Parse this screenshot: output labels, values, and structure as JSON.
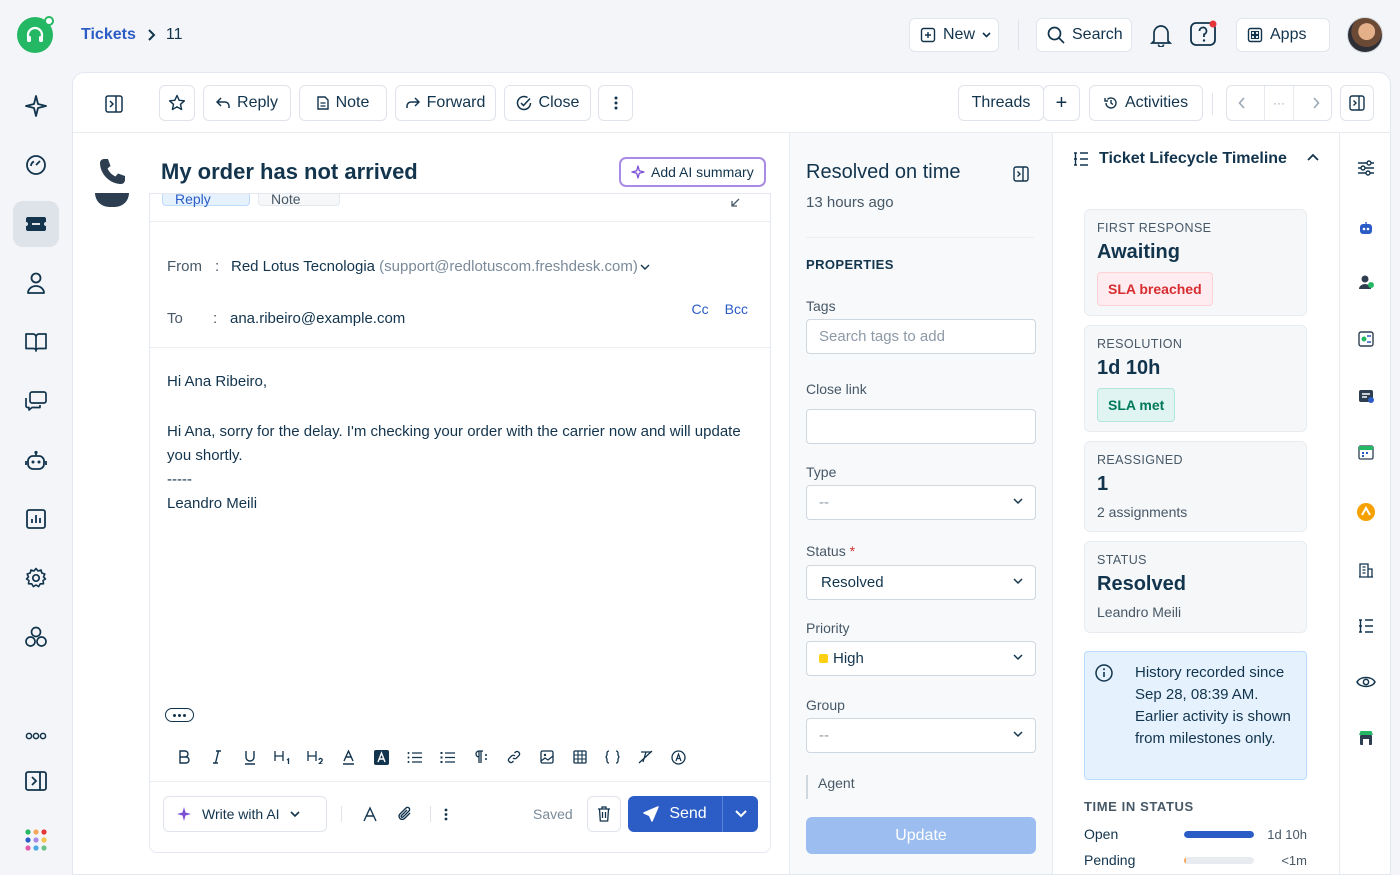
{
  "breadcrumb": {
    "parent": "Tickets",
    "separator": ">",
    "current": "11"
  },
  "topbar": {
    "new_label": "New",
    "search_label": "Search",
    "apps_label": "Apps"
  },
  "toolbar": {
    "reply": "Reply",
    "note": "Note",
    "forward": "Forward",
    "close": "Close",
    "threads": "Threads",
    "add": "+",
    "activities": "Activities",
    "ellipsis": "···"
  },
  "ticket": {
    "subject": "My order has not arrived",
    "ai_summary": "Add AI summary"
  },
  "editor": {
    "tab_reply": "Reply",
    "tab_note": "Note",
    "from_label": "From",
    "from_name": "Red Lotus Tecnologia",
    "from_email": "(support@redlotuscom.freshdesk.com)",
    "to_label": "To",
    "to_email": "ana.ribeiro@example.com",
    "cc": "Cc",
    "bcc": "Bcc",
    "body": [
      "Hi Ana Ribeiro,",
      "",
      "Hi Ana, sorry for the delay. I'm checking your order with the carrier now and will update you shortly.",
      "-----",
      "Leandro Meili"
    ],
    "write_ai": "Write with AI",
    "saved": "Saved",
    "send": "Send"
  },
  "properties": {
    "status_title": "Resolved on time",
    "status_time": "13 hours ago",
    "section": "PROPERTIES",
    "tags_label": "Tags",
    "tags_placeholder": "Search tags to add",
    "close_link_label": "Close link",
    "type_label": "Type",
    "type_value": "--",
    "status_label": "Status",
    "status_required": "*",
    "status_value": "Resolved",
    "priority_label": "Priority",
    "priority_value": "High",
    "priority_color": "#ffd012",
    "group_label": "Group",
    "group_value": "--",
    "agent_label": "Agent",
    "update": "Update"
  },
  "timeline": {
    "title": "Ticket Lifecycle Timeline",
    "first_response": {
      "label": "FIRST RESPONSE",
      "value": "Awaiting",
      "badge": "SLA breached"
    },
    "resolution": {
      "label": "RESOLUTION",
      "value": "1d 10h",
      "badge": "SLA met"
    },
    "reassigned": {
      "label": "REASSIGNED",
      "value": "1",
      "note": "2 assignments"
    },
    "status": {
      "label": "STATUS",
      "value": "Resolved",
      "note": "Leandro Meili"
    },
    "notice": "History recorded since Sep 28, 08:39 AM. Earlier activity is shown from milestones only.",
    "time_in_status_title": "TIME IN STATUS",
    "time_in_status": [
      {
        "name": "Open",
        "value": "1d 10h",
        "fraction": 1.0,
        "color": "#2c5cc5"
      },
      {
        "name": "Pending",
        "value": "<1m",
        "fraction": 0.02,
        "color": "#f6a75a"
      }
    ]
  },
  "colors": {
    "brand_green": "#25b864",
    "primary_blue": "#2c5cc5",
    "ai_purple": "#a98be7"
  }
}
